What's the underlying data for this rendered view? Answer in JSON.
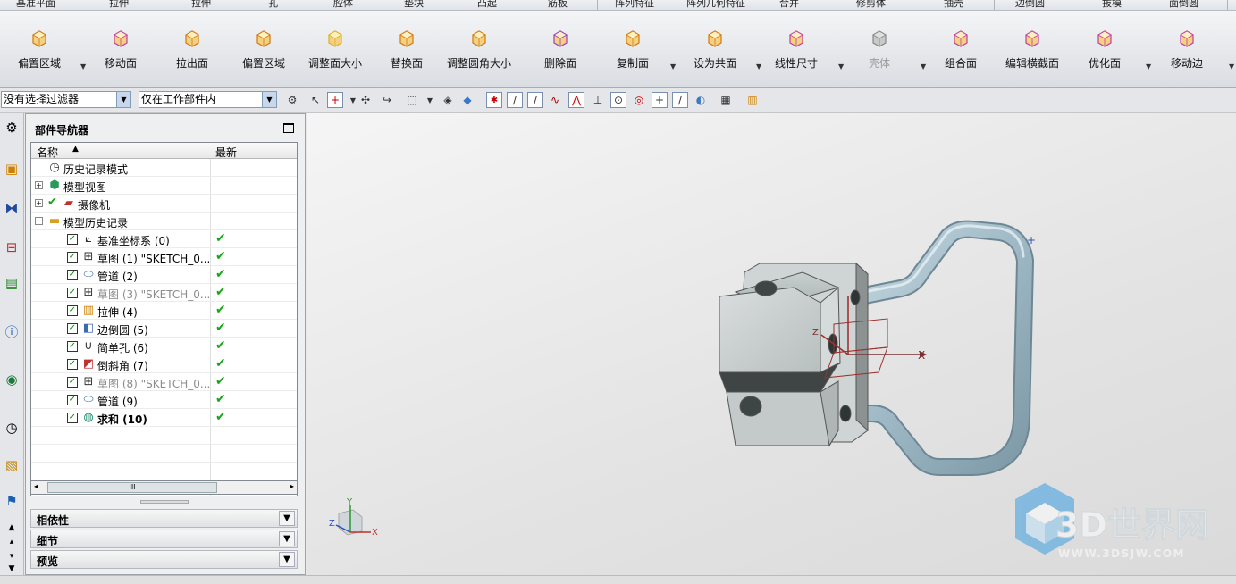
{
  "top_tabs": [
    "基准平面",
    "拉伸",
    "拉伸",
    "孔",
    "腔体",
    "垫块",
    "凸起",
    "筋板",
    "阵列特征",
    "阵列几何特征",
    "合并",
    "修剪体",
    "抽壳",
    "边倒圆",
    "拔模",
    "面倒圆"
  ],
  "ribbon": {
    "buttons": [
      {
        "label": "偏置区域",
        "icon": "offset-region-icon",
        "enabled": true
      },
      {
        "label": "移动面",
        "icon": "move-face-icon",
        "enabled": true
      },
      {
        "label": "拉出面",
        "icon": "pull-face-icon",
        "enabled": true
      },
      {
        "label": "偏置区域",
        "icon": "offset-region-icon",
        "enabled": true
      },
      {
        "label": "调整面大小",
        "icon": "resize-face-icon",
        "enabled": true
      },
      {
        "label": "替换面",
        "icon": "replace-face-icon",
        "enabled": true
      },
      {
        "label": "调整圆角大小",
        "icon": "resize-blend-icon",
        "enabled": true
      },
      {
        "label": "删除面",
        "icon": "delete-face-icon",
        "enabled": true
      },
      {
        "label": "复制面",
        "icon": "copy-face-icon",
        "enabled": true
      },
      {
        "label": "设为共面",
        "icon": "make-coplanar-icon",
        "enabled": true
      },
      {
        "label": "线性尺寸",
        "icon": "linear-dimension-icon",
        "enabled": true
      },
      {
        "label": "壳体",
        "icon": "shell-body-icon",
        "enabled": false
      },
      {
        "label": "组合面",
        "icon": "group-face-icon",
        "enabled": true
      },
      {
        "label": "编辑横截面",
        "icon": "edit-cross-section-icon",
        "enabled": true
      },
      {
        "label": "优化面",
        "icon": "optimize-face-icon",
        "enabled": true
      },
      {
        "label": "移动边",
        "icon": "move-edge-icon",
        "enabled": true
      }
    ]
  },
  "filter": {
    "selection_filter": "没有选择过滤器",
    "scope": "仅在工作部件内"
  },
  "navigator": {
    "title": "部件导航器",
    "col_name": "名称",
    "col_latest": "最新",
    "nodes": [
      {
        "label": "历史记录模式",
        "icon": "clock-icon",
        "level": 0,
        "expander": "",
        "checked": false,
        "latest": false,
        "style": "normal"
      },
      {
        "label": "模型视图",
        "icon": "model-view-icon",
        "level": 0,
        "expander": "+",
        "checked": false,
        "latest": false,
        "style": "normal"
      },
      {
        "label": "摄像机",
        "icon": "camera-icon",
        "level": 0,
        "expander": "+",
        "checked": false,
        "latest": false,
        "style": "normal"
      },
      {
        "label": "模型历史记录",
        "icon": "folder-icon",
        "level": 0,
        "expander": "-",
        "checked": false,
        "latest": false,
        "style": "normal"
      },
      {
        "label": "基准坐标系 (0)",
        "icon": "datum-csys-icon",
        "level": 1,
        "expander": "",
        "checked": true,
        "latest": true,
        "style": "normal"
      },
      {
        "label": "草图 (1) \"SKETCH_0...",
        "icon": "sketch-icon",
        "level": 1,
        "expander": "",
        "checked": true,
        "latest": true,
        "style": "normal"
      },
      {
        "label": "管道 (2)",
        "icon": "tube-icon",
        "level": 1,
        "expander": "",
        "checked": true,
        "latest": true,
        "style": "normal"
      },
      {
        "label": "草图 (3) \"SKETCH_0...",
        "icon": "sketch-icon",
        "level": 1,
        "expander": "",
        "checked": true,
        "latest": true,
        "style": "gray"
      },
      {
        "label": "拉伸 (4)",
        "icon": "extrude-icon",
        "level": 1,
        "expander": "",
        "checked": true,
        "latest": true,
        "style": "normal"
      },
      {
        "label": "边倒圆 (5)",
        "icon": "edge-blend-icon",
        "level": 1,
        "expander": "",
        "checked": true,
        "latest": true,
        "style": "normal"
      },
      {
        "label": "简单孔 (6)",
        "icon": "hole-icon",
        "level": 1,
        "expander": "",
        "checked": true,
        "latest": true,
        "style": "normal"
      },
      {
        "label": "倒斜角 (7)",
        "icon": "chamfer-icon",
        "level": 1,
        "expander": "",
        "checked": true,
        "latest": true,
        "style": "normal"
      },
      {
        "label": "草图 (8) \"SKETCH_0...",
        "icon": "sketch-icon",
        "level": 1,
        "expander": "",
        "checked": true,
        "latest": true,
        "style": "gray"
      },
      {
        "label": "管道 (9)",
        "icon": "tube-icon",
        "level": 1,
        "expander": "",
        "checked": true,
        "latest": true,
        "style": "normal"
      },
      {
        "label": "求和 (10)",
        "icon": "unite-icon",
        "level": 1,
        "expander": "",
        "checked": true,
        "latest": true,
        "style": "bold"
      }
    ],
    "scroll_thumb": "III",
    "panels": [
      "相依性",
      "细节",
      "预览"
    ]
  },
  "viewport": {
    "axis_x": "X",
    "axis_y": "Y",
    "axis_z": "Z",
    "watermark_title": "3D世界网",
    "watermark_url": "WWW.3DSJW.COM"
  }
}
